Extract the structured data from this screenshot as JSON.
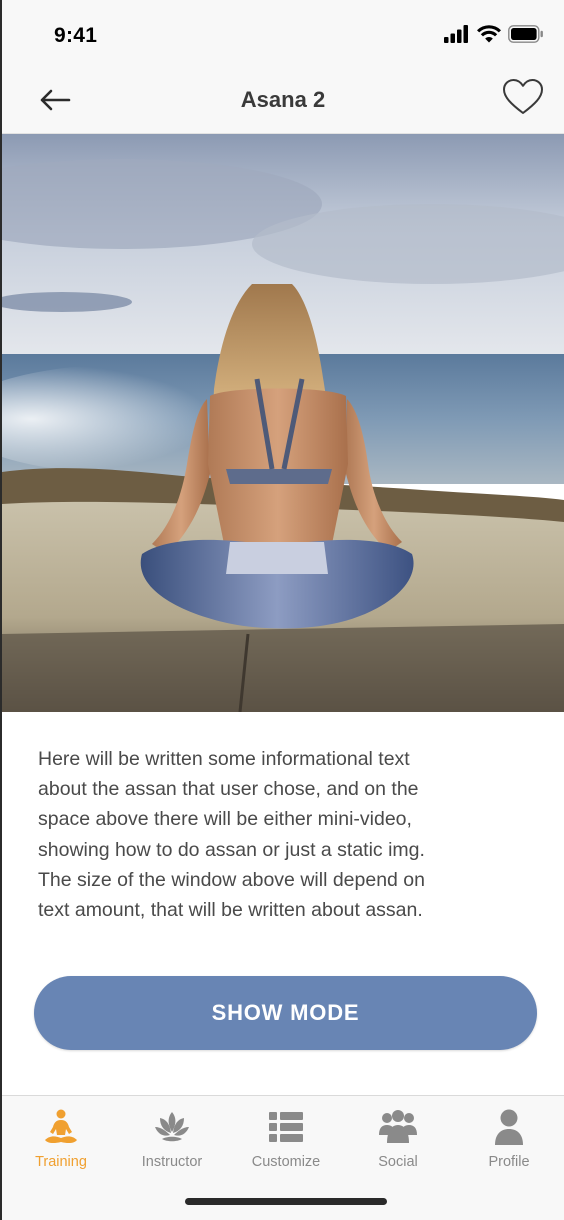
{
  "status_bar": {
    "time": "9:41"
  },
  "header": {
    "title": "Asana 2",
    "back_icon": "arrow-left-icon",
    "favorite_icon": "heart-outline-icon"
  },
  "hero": {
    "image": "woman meditating on rock by the sea"
  },
  "description": {
    "lines": [
      "Here will be written some informational text",
      "about the assan that user chose, and on the",
      "space above there will be either mini-video,",
      "showing how to do assan or just a static img.",
      "The size of the window above will depend on",
      "text amount, that will be written about assan."
    ]
  },
  "cta": {
    "label": "SHOW MODE",
    "color": "#6885b4"
  },
  "tab_bar": {
    "active_color": "#f0a030",
    "inactive_color": "#8a8a8a",
    "tabs": [
      {
        "label": "Training",
        "icon": "meditation-icon",
        "active": true
      },
      {
        "label": "Instructor",
        "icon": "lotus-icon",
        "active": false
      },
      {
        "label": "Customize",
        "icon": "list-icon",
        "active": false
      },
      {
        "label": "Social",
        "icon": "group-icon",
        "active": false
      },
      {
        "label": "Profile",
        "icon": "person-icon",
        "active": false
      }
    ]
  }
}
